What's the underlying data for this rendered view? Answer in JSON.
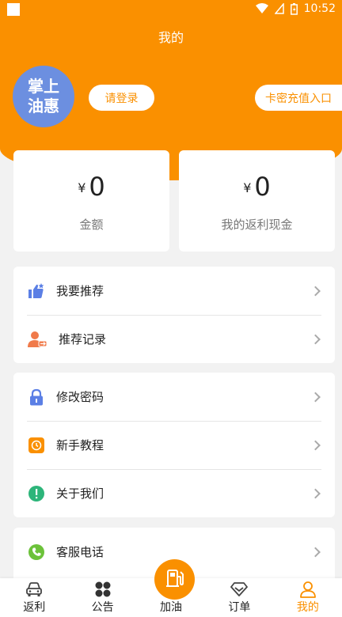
{
  "status_bar": {
    "time": "10:52"
  },
  "header": {
    "title": "我的"
  },
  "profile": {
    "avatar_line1": "掌上",
    "avatar_line2": "油惠",
    "login_label": "请登录",
    "recharge_label": "卡密充值入口"
  },
  "stats": [
    {
      "currency": "¥",
      "value": "0",
      "label": "金额"
    },
    {
      "currency": "¥",
      "value": "0",
      "label": "我的返利现金"
    }
  ],
  "menu_groups": [
    {
      "items": [
        {
          "label": "我要推荐",
          "icon": "thumbs-up-icon",
          "color": "#5b7fe5"
        },
        {
          "label": "推荐记录",
          "icon": "user-record-icon",
          "color": "#f07a4a"
        }
      ]
    },
    {
      "items": [
        {
          "label": "修改密码",
          "icon": "lock-icon",
          "color": "#5b7fe5"
        },
        {
          "label": "新手教程",
          "icon": "tutorial-icon",
          "color": "#fa9000"
        },
        {
          "label": "关于我们",
          "icon": "info-icon",
          "color": "#2db57a"
        }
      ]
    },
    {
      "items": [
        {
          "label": "客服电话",
          "icon": "phone-icon",
          "color": "#6cc23a"
        }
      ]
    }
  ],
  "bottom_nav": [
    {
      "label": "返利",
      "icon": "car-icon"
    },
    {
      "label": "公告",
      "icon": "grid-icon"
    },
    {
      "label": "加油",
      "icon": "fuel-pump-icon"
    },
    {
      "label": "订单",
      "icon": "diamond-icon"
    },
    {
      "label": "我的",
      "icon": "person-icon",
      "active": true
    }
  ],
  "colors": {
    "brand": "#fa9000",
    "avatar": "#6c8fe0",
    "background": "#f2f2f2"
  }
}
